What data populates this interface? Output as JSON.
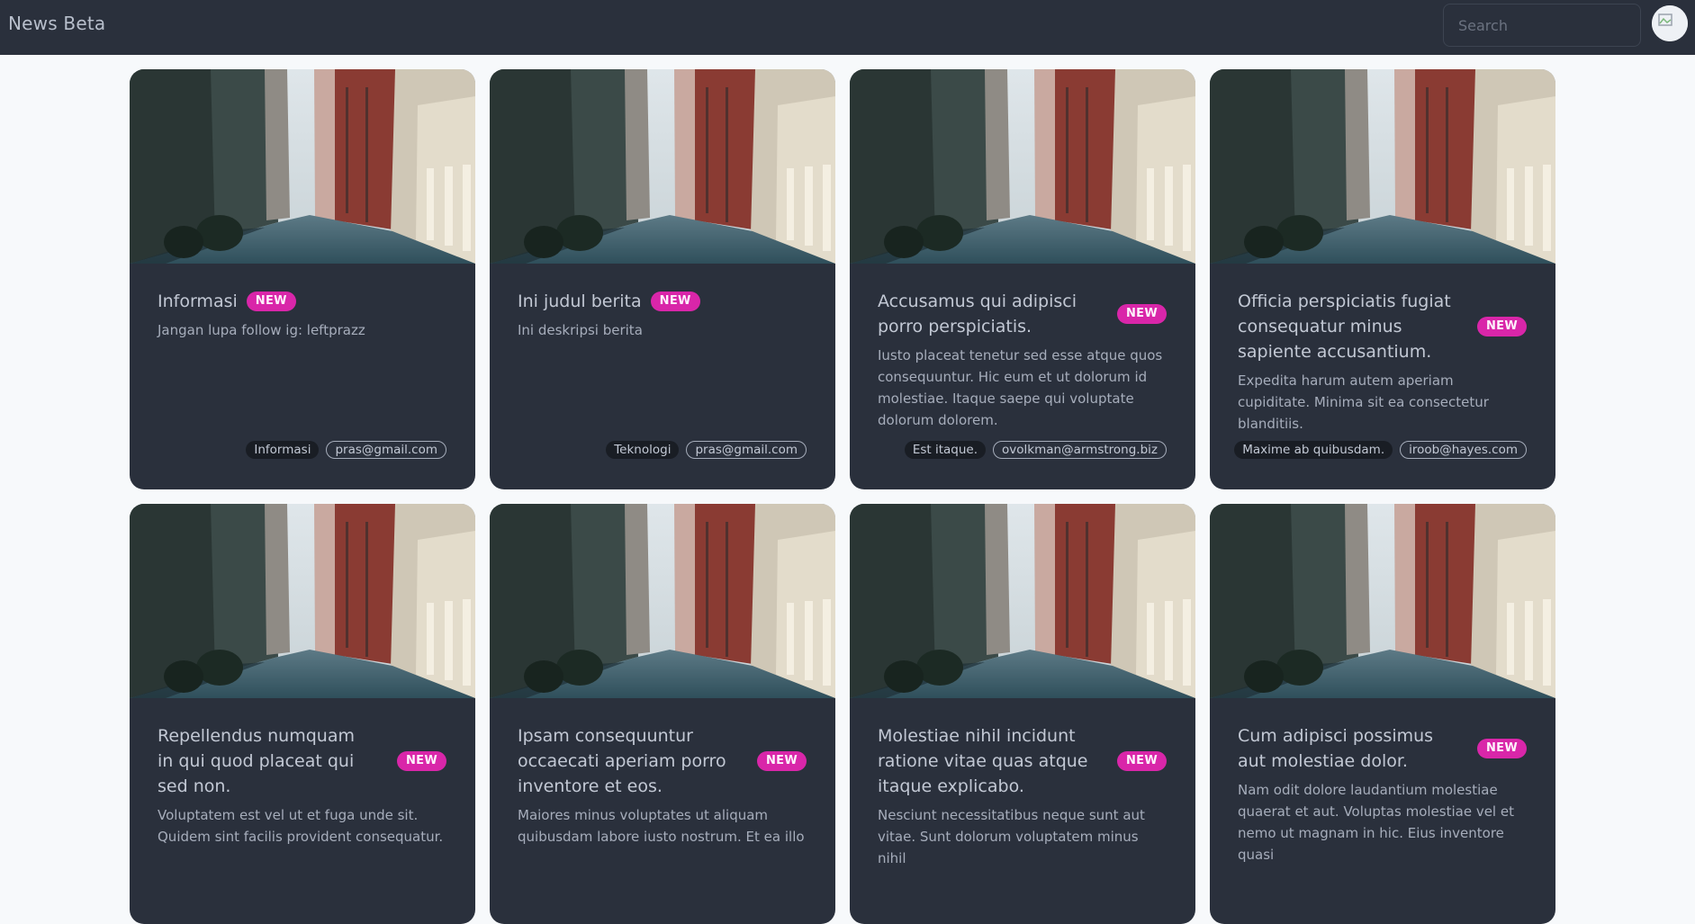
{
  "navbar": {
    "brand": "News Beta",
    "search_placeholder": "Search"
  },
  "badge_label": "NEW",
  "cards": [
    {
      "title": "Informasi",
      "description": "Jangan lupa follow ig: leftprazz",
      "category": "Informasi",
      "author": "pras@gmail.com"
    },
    {
      "title": "Ini judul berita",
      "description": "Ini deskripsi berita",
      "category": "Teknologi",
      "author": "pras@gmail.com"
    },
    {
      "title": "Accusamus qui adipisci porro perspiciatis.",
      "description": "Iusto placeat tenetur sed esse atque quos consequuntur. Hic eum et ut dolorum id molestiae. Itaque saepe qui voluptate dolorum dolorem.",
      "category": "Est itaque.",
      "author": "ovolkman@armstrong.biz"
    },
    {
      "title": "Officia perspiciatis fugiat consequatur minus sapiente accusantium.",
      "description": "Expedita harum autem aperiam cupiditate. Minima sit ea consectetur blanditiis.",
      "category": "Maxime ab quibusdam.",
      "author": "iroob@hayes.com"
    },
    {
      "title": "Repellendus numquam in qui quod placeat qui sed non.",
      "description": "Voluptatem est vel ut et fuga unde sit. Quidem sint facilis provident consequatur.",
      "category": "",
      "author": ""
    },
    {
      "title": "Ipsam consequuntur occaecati aperiam porro inventore et eos.",
      "description": "Maiores minus voluptates ut aliquam quibusdam labore iusto nostrum. Et ea illo",
      "category": "",
      "author": ""
    },
    {
      "title": "Molestiae nihil incidunt ratione vitae quas atque itaque explicabo.",
      "description": "Nesciunt necessitatibus neque sunt aut vitae. Sunt dolorum voluptatem minus nihil",
      "category": "",
      "author": ""
    },
    {
      "title": "Cum adipisci possimus aut molestiae dolor.",
      "description": "Nam odit dolore laudantium molestiae quaerat et aut. Voluptas molestiae vel et nemo ut magnam in hic. Eius inventore quasi",
      "category": "",
      "author": ""
    }
  ]
}
